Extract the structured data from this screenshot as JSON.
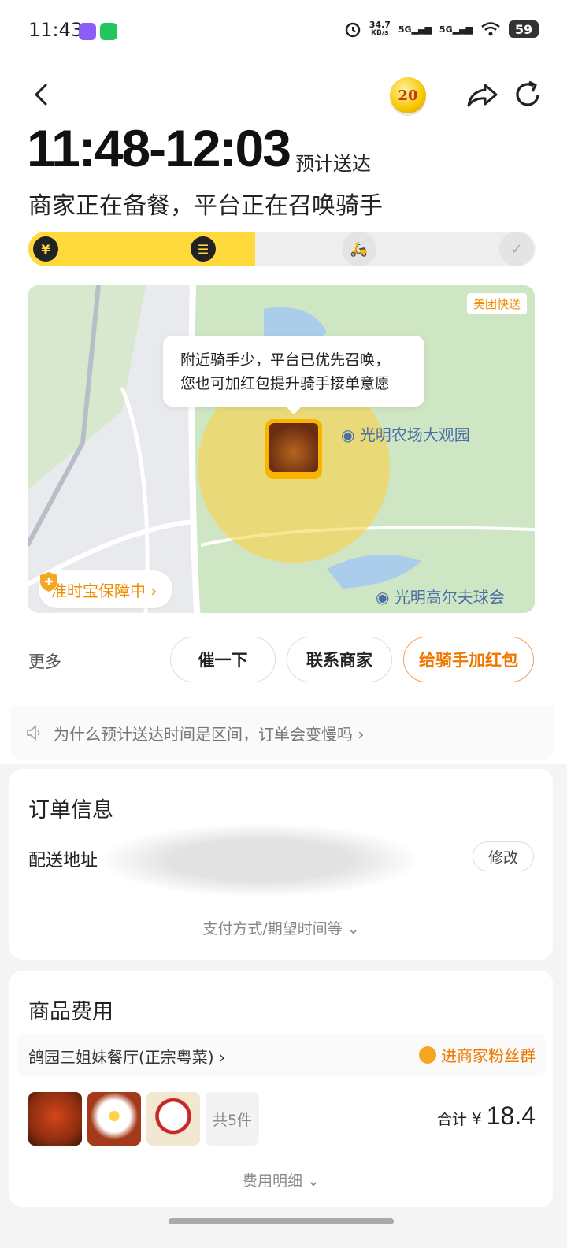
{
  "status_bar": {
    "time": "11:43",
    "speed_value": "34.7",
    "speed_unit": "KB/s",
    "signal1": "5G",
    "signal2": "5G",
    "battery": "59"
  },
  "header": {
    "coin_value": "20"
  },
  "eta": {
    "range": "11:48-12:03",
    "label": "预计送达",
    "status": "商家正在备餐，平台正在召唤骑手"
  },
  "progress": {
    "fraction": 0.45,
    "steps": [
      "paid",
      "preparing",
      "rider",
      "delivered"
    ]
  },
  "map": {
    "badge": "美团快送",
    "bubble_line1": "附近骑手少，平台已优先召唤，",
    "bubble_line2": "您也可加红包提升骑手接单意愿",
    "poi1": "光明农场大观园",
    "poi2": "光明高尔夫球会",
    "guarantee": "准时宝保障中 ›"
  },
  "actions": {
    "more": "更多",
    "urge": "催一下",
    "contact": "联系商家",
    "tip": "给骑手加红包"
  },
  "notice": "为什么预计送达时间是区间，订单会变慢吗 ›",
  "order_info": {
    "title": "订单信息",
    "address_label": "配送地址",
    "edit": "修改",
    "pay_toggle": "支付方式/期望时间等 ⌄"
  },
  "fees": {
    "title": "商品费用",
    "shop": "鸽园三姐妹餐厅(正宗粤菜) ›",
    "fans": "进商家粉丝群",
    "item_count": "共5件",
    "total_label": "合计",
    "currency": "¥",
    "total": "18.4",
    "detail_toggle": "费用明细 ⌄"
  }
}
